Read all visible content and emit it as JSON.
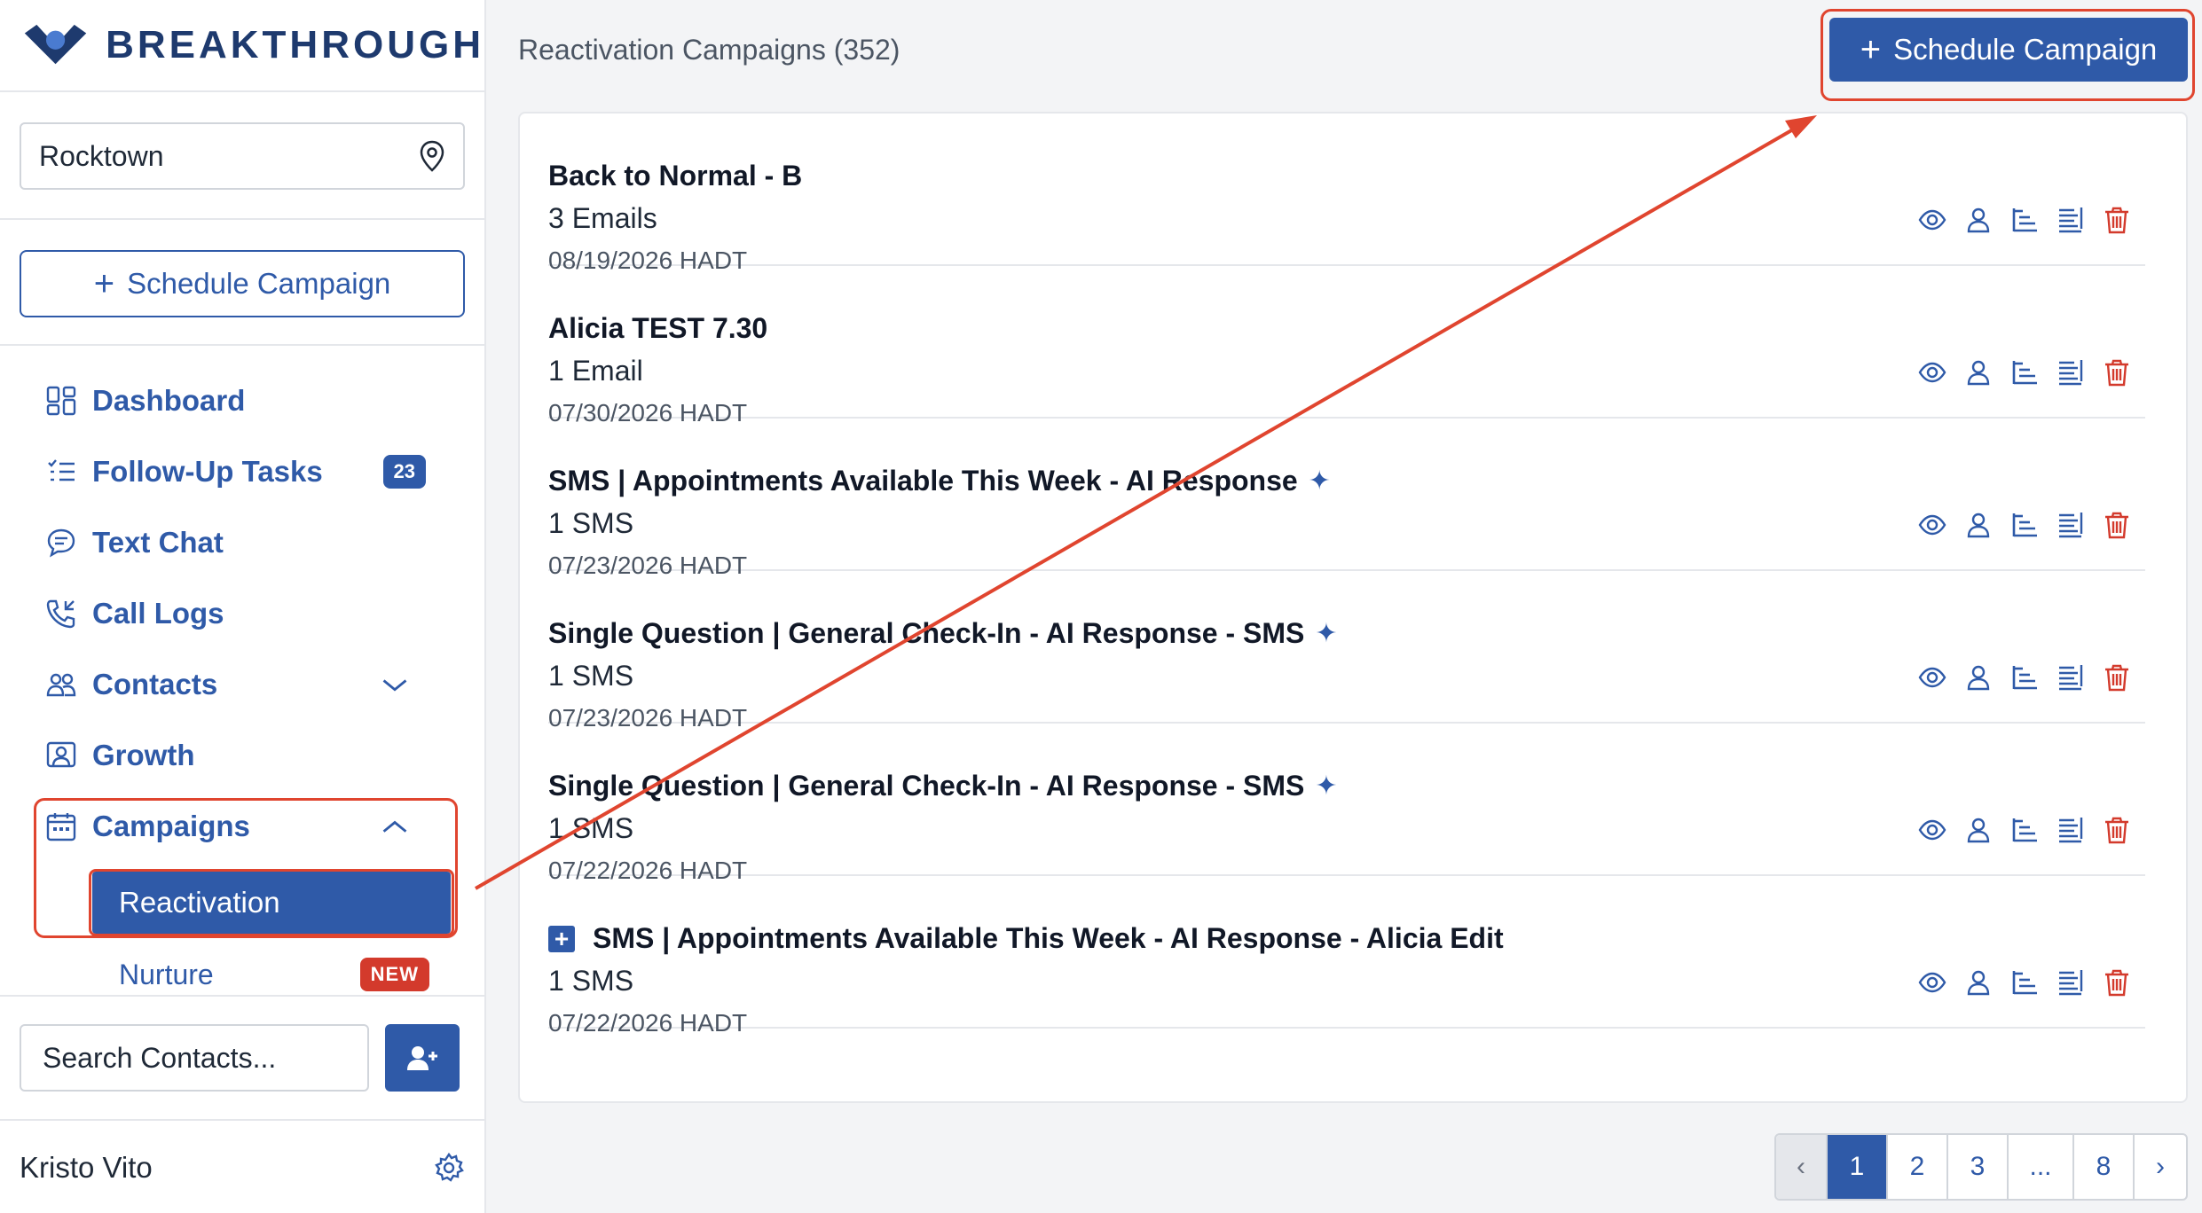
{
  "brand": {
    "name": "BREAKTHROUGH"
  },
  "location": {
    "value": "Rocktown",
    "icon": "map-pin-icon"
  },
  "sidebar_schedule_label": "Schedule Campaign",
  "nav": {
    "dashboard": "Dashboard",
    "followup": "Follow-Up Tasks",
    "followup_count": "23",
    "textchat": "Text Chat",
    "calllogs": "Call Logs",
    "contacts": "Contacts",
    "growth": "Growth",
    "campaigns": "Campaigns",
    "reactivation": "Reactivation",
    "nurture": "Nurture",
    "nurture_badge": "NEW"
  },
  "search": {
    "placeholder": "Search Contacts..."
  },
  "user": {
    "name": "Kristo Vito"
  },
  "main": {
    "title": "Reactivation Campaigns (352)",
    "schedule_label": "Schedule Campaign"
  },
  "campaigns": [
    {
      "title": "Back to Normal - B",
      "sub": "3 Emails",
      "date": "08/19/2026 HADT",
      "ai": false,
      "expandable": false
    },
    {
      "title": "Alicia TEST 7.30",
      "sub": "1 Email",
      "date": "07/30/2026 HADT",
      "ai": false,
      "expandable": false
    },
    {
      "title": "SMS | Appointments Available This Week - AI Response",
      "sub": "1 SMS",
      "date": "07/23/2026 HADT",
      "ai": true,
      "expandable": false
    },
    {
      "title": "Single Question | General Check-In - AI Response - SMS",
      "sub": "1 SMS",
      "date": "07/23/2026 HADT",
      "ai": true,
      "expandable": false
    },
    {
      "title": "Single Question | General Check-In - AI Response - SMS",
      "sub": "1 SMS",
      "date": "07/22/2026 HADT",
      "ai": true,
      "expandable": false
    },
    {
      "title": "SMS | Appointments Available This Week - AI Response - Alicia Edit",
      "sub": "1 SMS",
      "date": "07/22/2026 HADT",
      "ai": false,
      "expandable": true
    }
  ],
  "pagination": {
    "prev": "‹",
    "pages": [
      "1",
      "2",
      "3",
      "...",
      "8"
    ],
    "current": "1",
    "next": "›"
  },
  "colors": {
    "accent": "#2f5aa8",
    "danger": "#d33a2c",
    "highlight": "#e0452f"
  }
}
